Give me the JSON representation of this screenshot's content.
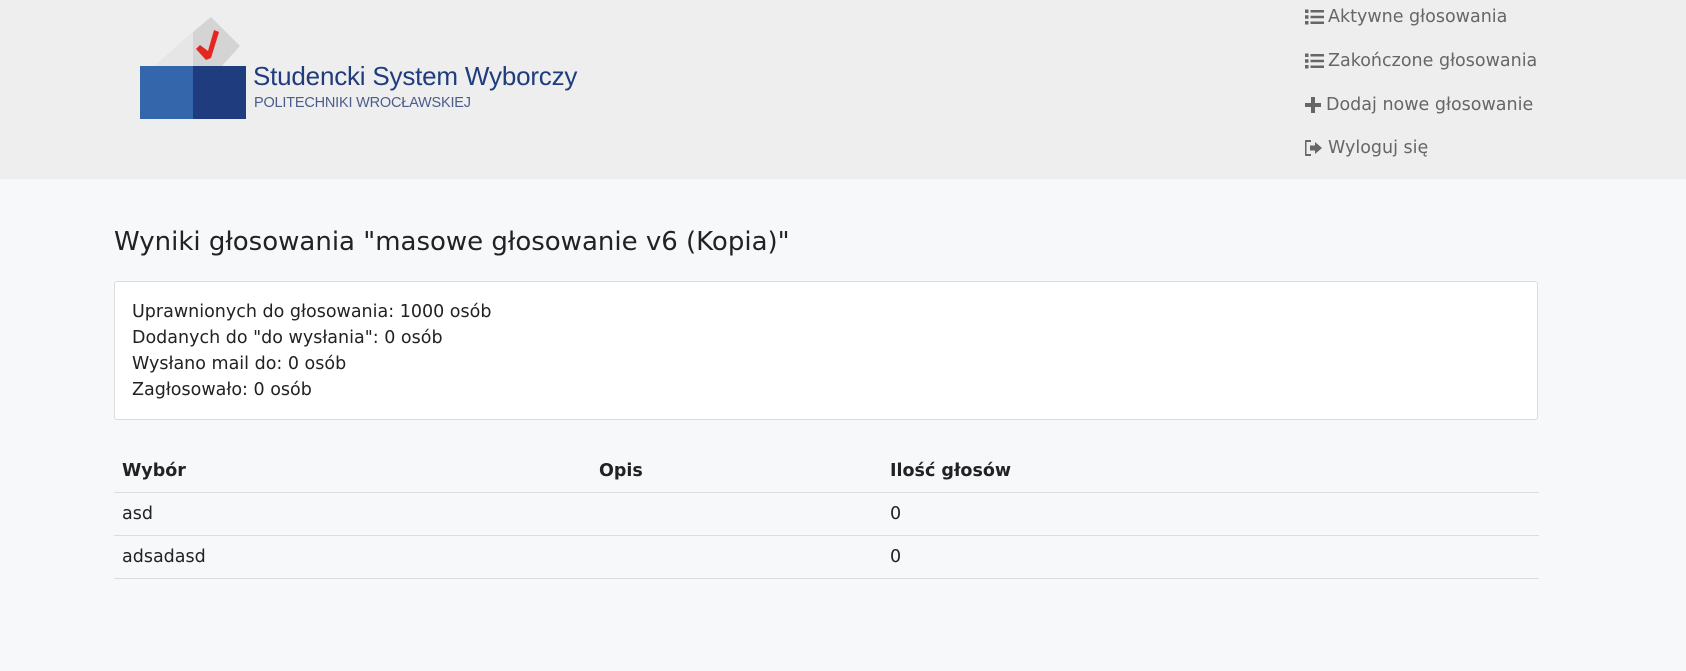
{
  "header": {
    "logo": {
      "title": "Studencki System Wyborczy",
      "subtitle": "POLITECHNIKI WROCŁAWSKIEJ",
      "colors": {
        "box_light": "#3366aa",
        "box_dark": "#1f3c7e",
        "ballot": "#d4d4d4",
        "check": "#e52521"
      }
    },
    "nav": [
      {
        "label": "Aktywne głosowania",
        "icon": "list-icon"
      },
      {
        "label": "Zakończone głosowania",
        "icon": "list-icon"
      },
      {
        "label": "Dodaj nowe głosowanie",
        "icon": "plus-icon"
      },
      {
        "label": "Wyloguj się",
        "icon": "sign-out-icon"
      }
    ]
  },
  "main": {
    "title": "Wyniki głosowania \"masowe głosowanie v6 (Kopia)\"",
    "stats": [
      "Uprawnionych do głosowania: 1000 osób",
      "Dodanych do \"do wysłania\": 0 osób",
      "Wysłano mail do: 0 osób",
      "Zagłosowało: 0 osób"
    ],
    "table": {
      "headers": [
        "Wybór",
        "Opis",
        "Ilość głosów"
      ],
      "rows": [
        [
          "asd",
          "",
          "0"
        ],
        [
          "adsadasd",
          "",
          "0"
        ]
      ]
    }
  },
  "colors": {
    "header_bg": "#eeeeee",
    "page_bg": "#f7f8fa",
    "nav_text": "#666666"
  }
}
